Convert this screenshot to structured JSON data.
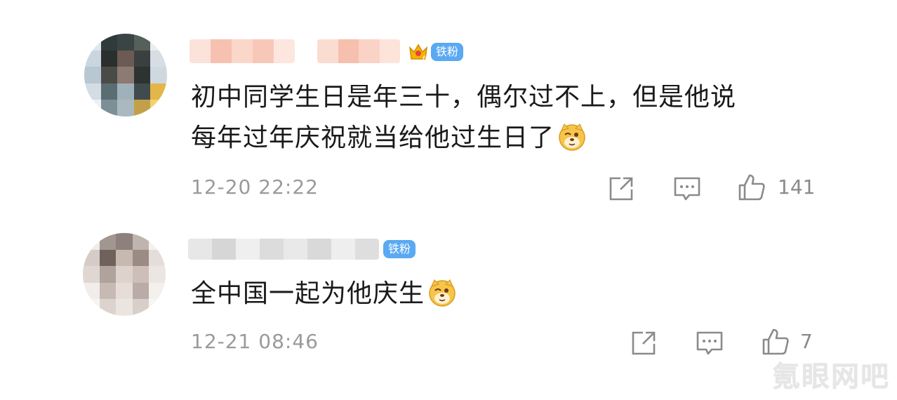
{
  "comments": [
    {
      "badge": "铁粉",
      "text_line1": "初中同学生日是年三十，偶尔过不上，但是他说",
      "text_line2": "每年过年庆祝就当给他过生日了",
      "time": "12-20 22:22",
      "likes": "141",
      "emoji": "doge-emoji"
    },
    {
      "badge": "铁粉",
      "text_line1": "全中国一起为他庆生",
      "time": "12-21 08:46",
      "likes": "7",
      "emoji": "doge-emoji"
    }
  ],
  "watermark": "氪眼网吧",
  "colors": {
    "badge_bg": "#5aa9f2",
    "text": "#1a1a1a",
    "meta": "#9a9a9a",
    "icon": "#8a8a8a"
  }
}
